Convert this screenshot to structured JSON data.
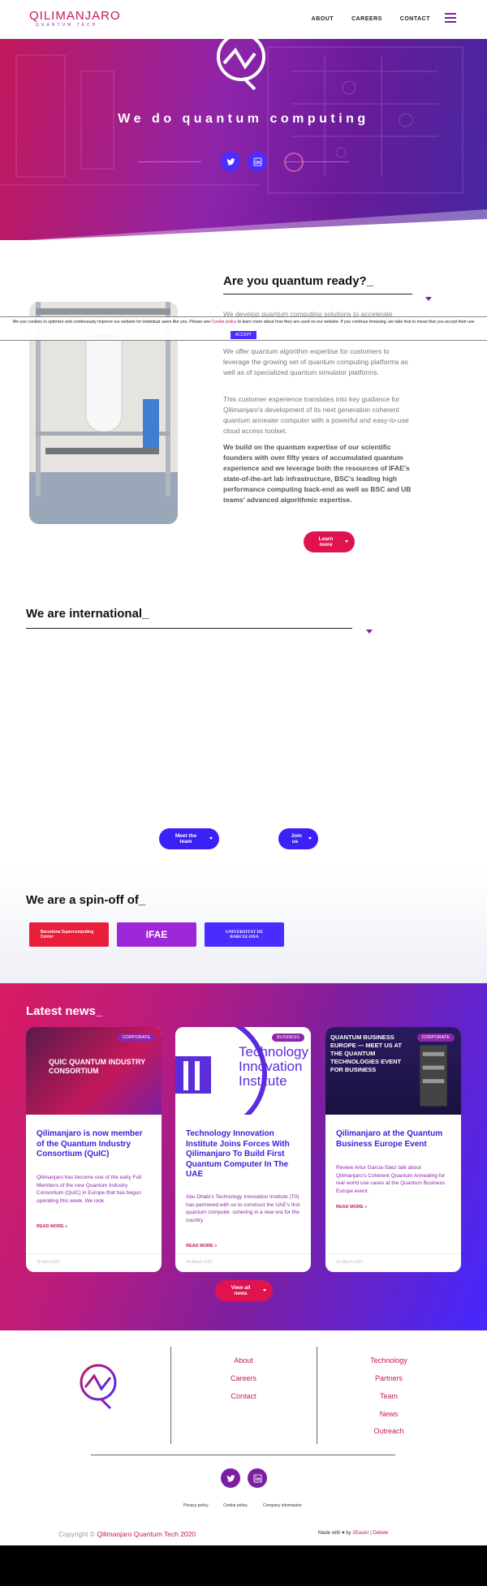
{
  "brand": {
    "logo_text": "QILIMANJARO",
    "logo_sub": "QUANTUM TECH",
    "primary": "#c2185b",
    "purple": "#7b1fa2",
    "blue": "#4a2cff"
  },
  "nav": {
    "items": [
      "ABOUT",
      "CAREERS",
      "CONTACT"
    ],
    "menu_icon": "hamburger-icon"
  },
  "hero": {
    "title": "We do quantum computing",
    "social": [
      "twitter-icon",
      "linkedin-icon"
    ]
  },
  "cookie": {
    "text_before": "We use cookies to optimize and continuously improve our website for individual users like you. Please see ",
    "link": "Cookie policy",
    "text_after": " to learn more about how they are used on our website. If you continue browsing, we take that to mean that you accept their use",
    "button": "ACCEPT"
  },
  "about": {
    "title": "Are you quantum ready?_",
    "p1": "We develop quantum computing solutions to accelerate",
    "p2": "We offer quantum algorithm expertise for customers to leverage the growing set of quantum computing platforms as well as of specialized quantum simulator platforms.",
    "p3": "This customer experience translates into key guidance for Qilimanjaro's development of its next generation coherent quantum annealer computer with a powerful and easy-to-use cloud access toolset.",
    "p4": "We build on the quantum expertise of our scientific founders with over fifty years of accumulated quantum experience and we leverage both the resources of IFAE's state-of-the-art lab infrastructure, BSC's leading high performance computing back-end as well as BSC and UB teams' advanced algorithmic expertise.",
    "button": "Learn more"
  },
  "international": {
    "title": "We are international_",
    "button_team": "Meet the team",
    "button_join": "Join us"
  },
  "spinoff": {
    "title": "We are a spin-off of_",
    "partners": [
      {
        "name": "Barcelona Supercomputing Center",
        "color": "#e91e3a"
      },
      {
        "name": "IFAE",
        "color": "#9c27d8"
      },
      {
        "name": "UNIVERSITAT DE BARCELONA",
        "color": "#4a2cff"
      }
    ]
  },
  "news": {
    "title": "Latest news_",
    "read_more": "READ MORE »",
    "view_all": "View all news",
    "cards": [
      {
        "badge": "CORPORATE",
        "image_text": "QUIC QUANTUM INDUSTRY CONSORTIUM",
        "title": "Qilimanjaro is now member of the Quantum Industry Consortium (QuIC)",
        "text": "Qilimanjaro has become one of the early Full Members of the new Quantum Industry Consortium (QuIC) in Europe that has begun operating this week. We look",
        "date": "16 April 2021"
      },
      {
        "badge": "BUSINESS",
        "image_text": "Technology Innovation Institute",
        "title": "Technology Innovation Institute Joins Forces With Qilimanjaro To Build First Quantum Computer In The UAE",
        "text": "Abu Dhabi's Technology Innovation Institute (TII) has partnered with us to construct the UAE's first quantum computer, ushering in a new era for the country",
        "date": "24 March 2021"
      },
      {
        "badge": "CORPORATE",
        "image_text": "QUANTUM BUSINESS EUROPE — MEET US AT THE QUANTUM TECHNOLOGIES EVENT FOR BUSINESS",
        "title": "Qilimanjaro at the Quantum Business Europe Event",
        "text": "Review Artur Garcia-Sáez talk about Qilimanjaro's Coherent Quantum Annealing for real world use cases at the Quantum Business Europe event.",
        "date": "22 March 2021"
      }
    ]
  },
  "footer": {
    "col1": [
      "About",
      "Careers",
      "Contact"
    ],
    "col2": [
      "Technology",
      "Partners",
      "Team",
      "News",
      "Outreach"
    ],
    "legal": [
      "Privacy policy",
      "Cookie policy",
      "Company information"
    ],
    "copyright_prefix": "Copyright © ",
    "copyright_name": "Qilimanjaro Quantum Tech 2020",
    "made_with_prefix": "Made with ♥ by ",
    "made_with_a": "2Easier",
    "made_with_sep": " | ",
    "made_with_b": "Debele"
  }
}
